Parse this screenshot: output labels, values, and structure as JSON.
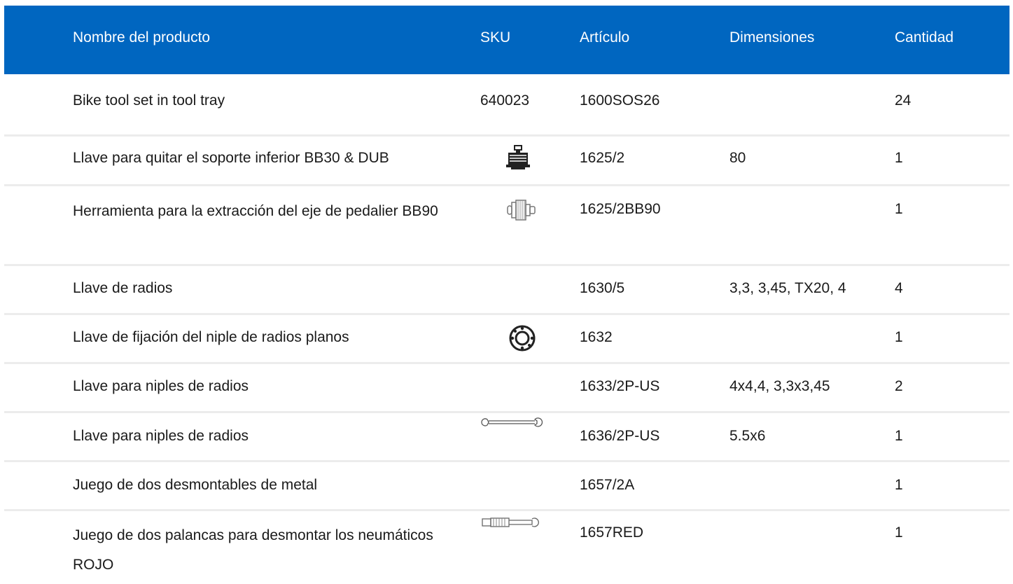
{
  "table": {
    "headers": {
      "name": "Nombre del producto",
      "sku": "SKU",
      "article": "Artículo",
      "dimensions": "Dimensiones",
      "quantity": "Cantidad"
    },
    "rows": [
      {
        "name": "Bike tool set in tool tray",
        "sku": "640023",
        "article": "1600SOS26",
        "dimensions": "",
        "quantity": "24",
        "icon": ""
      },
      {
        "name": "Llave para quitar el soporte inferior BB30 & DUB",
        "sku": "",
        "article": "1625/2",
        "dimensions": "80",
        "quantity": "1",
        "icon": "bottom-bracket-tool-icon"
      },
      {
        "name": "Herramienta para la extracción del eje de pedalier BB90",
        "sku": "",
        "article": "1625/2BB90",
        "dimensions": "",
        "quantity": "1",
        "icon": "bb90-extractor-icon"
      },
      {
        "name": "Llave de radios",
        "sku": "",
        "article": "1630/5",
        "dimensions": "3,3, 3,45, TX20, 4",
        "quantity": "4",
        "icon": ""
      },
      {
        "name": "Llave de fijación del niple de radios planos",
        "sku": "",
        "article": "1632",
        "dimensions": "",
        "quantity": "1",
        "icon": "nipple-ring-tool-icon"
      },
      {
        "name": "Llave para niples de radios",
        "sku": "",
        "article": "1633/2P-US",
        "dimensions": "4x4,4, 3,3x3,45",
        "quantity": "2",
        "icon": ""
      },
      {
        "name": "Llave para niples de radios",
        "sku": "",
        "article": "1636/2P-US",
        "dimensions": "5.5x6",
        "quantity": "1",
        "icon": "spoke-wrench-icon"
      },
      {
        "name": "Juego de dos desmontables de metal",
        "sku": "",
        "article": "1657/2A",
        "dimensions": "",
        "quantity": "1",
        "icon": ""
      },
      {
        "name": "Juego de dos palancas para desmontar los neumáticos ROJO",
        "sku": "",
        "article": "1657RED",
        "dimensions": "",
        "quantity": "1",
        "icon": "tire-lever-icon"
      }
    ]
  }
}
